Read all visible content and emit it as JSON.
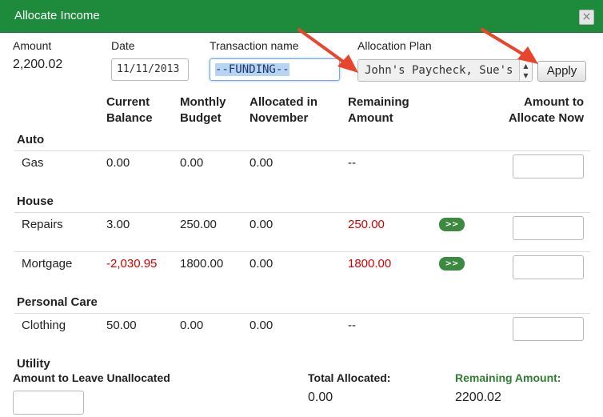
{
  "dialog": {
    "title": "Allocate Income",
    "close_glyph": "×"
  },
  "header": {
    "amount_label": "Amount",
    "amount_value": "2,200.02",
    "date_label": "Date",
    "date_value": "11/11/2013",
    "name_label": "Transaction name",
    "name_value": "--FUNDING--",
    "plan_label": "Allocation Plan",
    "plan_value": "John's Paycheck, Sue's Pa",
    "apply_label": "Apply"
  },
  "columns": {
    "current_balance": [
      "Current",
      "Balance"
    ],
    "monthly_budget": [
      "Monthly",
      "Budget"
    ],
    "allocated": [
      "Allocated in",
      "November"
    ],
    "remaining": [
      "Remaining",
      "Amount"
    ],
    "allocate_now": [
      "Amount to",
      "Allocate Now"
    ]
  },
  "categories": [
    {
      "name": "Auto",
      "rows": [
        {
          "name": "Gas",
          "balance": "0.00",
          "budget": "0.00",
          "allocated": "0.00",
          "remaining": "--"
        }
      ]
    },
    {
      "name": "House",
      "rows": [
        {
          "name": "Repairs",
          "balance": "3.00",
          "budget": "250.00",
          "allocated": "0.00",
          "remaining": "250.00",
          "move_label": ">>"
        },
        {
          "name": "Mortgage",
          "balance": "-2,030.95",
          "budget": "1800.00",
          "allocated": "0.00",
          "remaining": "1800.00",
          "move_label": ">>"
        }
      ]
    },
    {
      "name": "Personal Care",
      "rows": [
        {
          "name": "Clothing",
          "balance": "50.00",
          "budget": "0.00",
          "allocated": "0.00",
          "remaining": "--"
        }
      ]
    },
    {
      "name": "Utility",
      "rows": []
    }
  ],
  "footer": {
    "leave_label": "Amount to Leave Unallocated",
    "total_label": "Total Allocated:",
    "total_value": "0.00",
    "remaining_label": "Remaining Amount:",
    "remaining_value": "2200.02"
  },
  "colors": {
    "title_bar": "#1e8b3c",
    "negative": "#d40000",
    "remaining_label": "#2e7d32",
    "annotation_arrow": "#e8452c",
    "move_button": "#3c8a3f"
  }
}
